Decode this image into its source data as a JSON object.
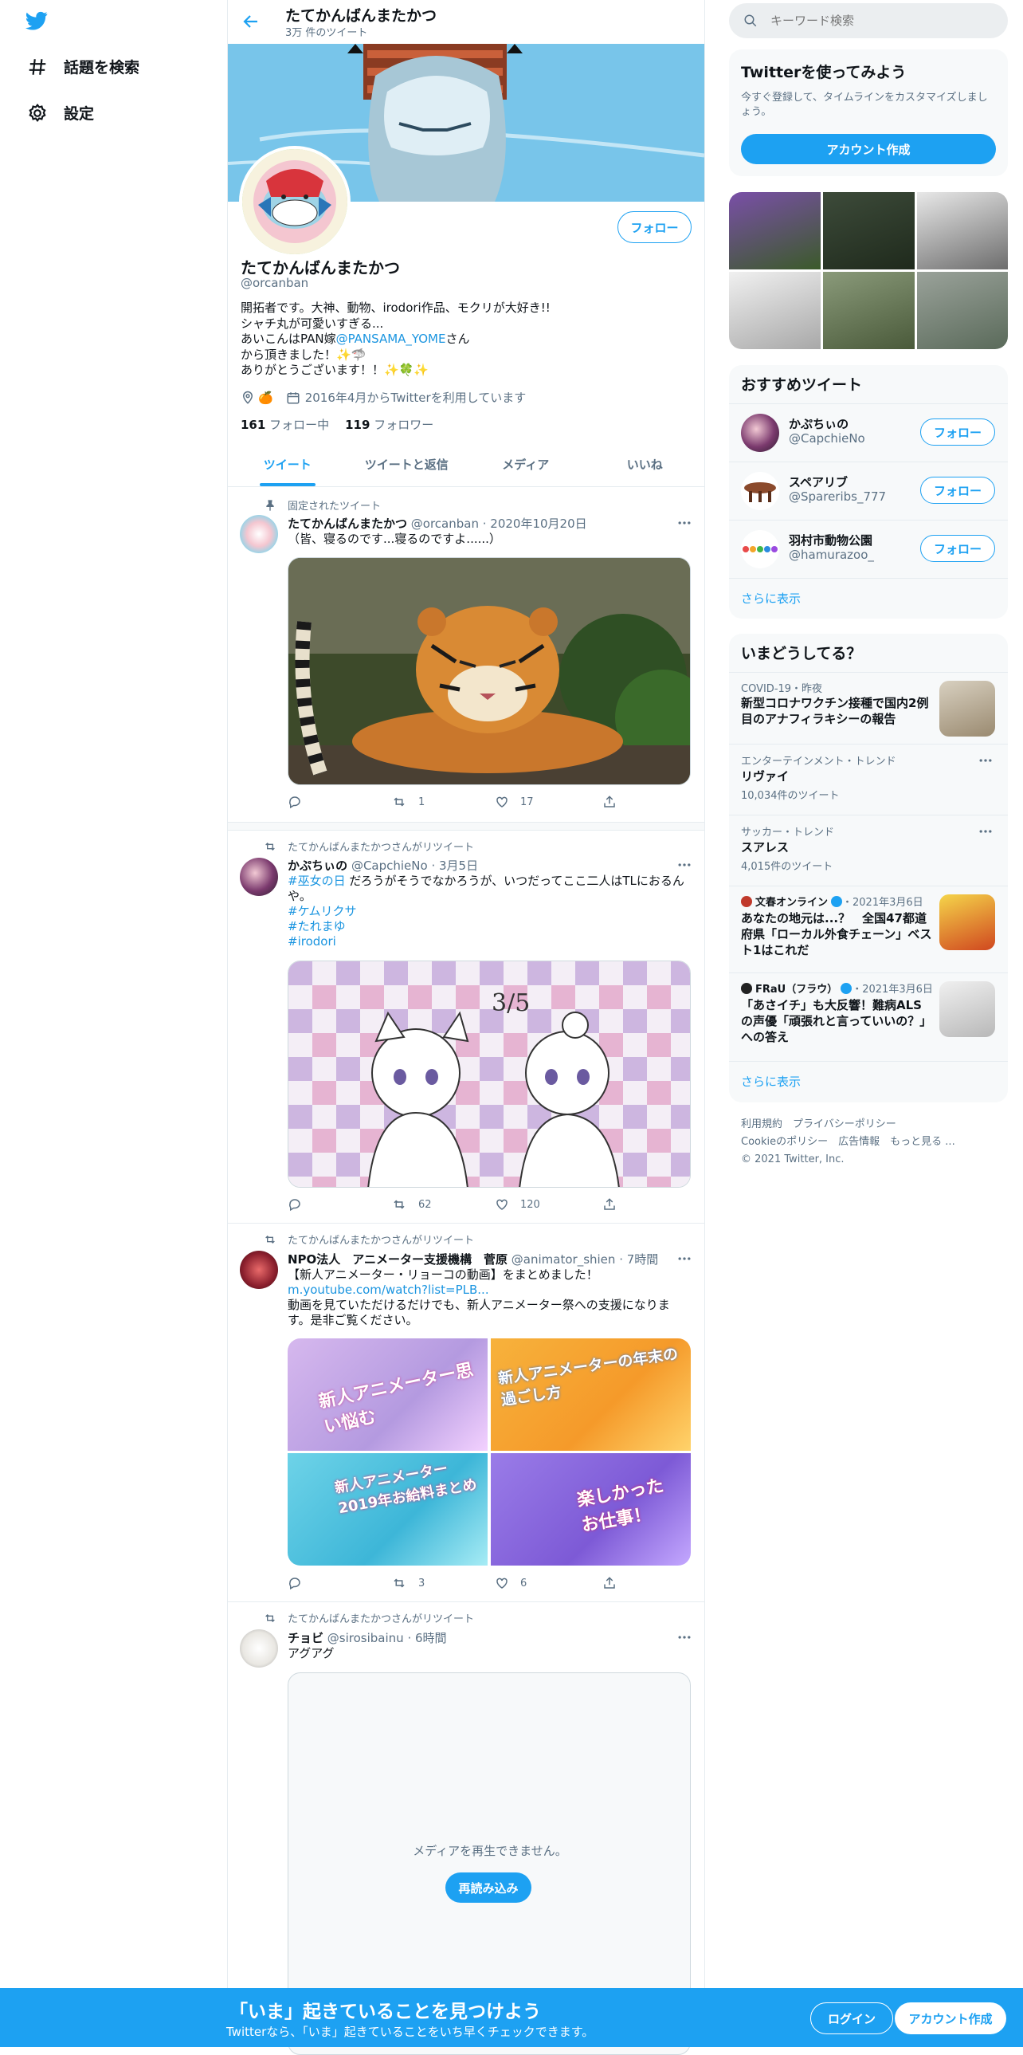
{
  "nav": {
    "explore_label": "話題を検索",
    "settings_label": "設定"
  },
  "profile": {
    "display_name": "たてかんばんまたかつ",
    "tweet_count": "3万 件のツイート",
    "handle": "@orcanban",
    "follow_button": "フォロー",
    "bio_lines": [
      "開拓者です。大神、動物、irodori作品、モクリが大好き!!",
      "シャチ丸が可愛いすぎる...",
      "あいこんはPAN嫁",
      "さん",
      "から頂きました！✨🦈",
      "ありがとうございます！！✨🍀✨"
    ],
    "bio_mention": "@PANSAMA_YOME",
    "location_emoji": "🍊",
    "joined": "2016年4月からTwitterを利用しています",
    "following_count": "161",
    "following_label": "フォロー中",
    "followers_count": "119",
    "followers_label": "フォロワー"
  },
  "tabs": [
    "ツイート",
    "ツイートと返信",
    "メディア",
    "いいね"
  ],
  "tweets": [
    {
      "context": "固定されたツイート",
      "name": "たてかんばんまたかつ",
      "handle": "@orcanban",
      "time": "2020年10月20日",
      "text": "（皆、寝るのです...寝るのですよ......）",
      "reply": "",
      "retweet": "1",
      "like": "17"
    },
    {
      "context": "たてかんばんまたかつさんがリツイート",
      "name": "かぷちぃの",
      "handle": "@CapchieNo",
      "time": "3月5日",
      "hashtag1": "#巫女の日",
      "text": " だろうがそうでなかろうが、いつだってここ二人はTLにおるんや。",
      "hashtag2": "#ケムリクサ",
      "hashtag3": "#たれまゆ",
      "hashtag4": "#irodori",
      "media_label": "3/5",
      "reply": "",
      "retweet": "62",
      "like": "120"
    },
    {
      "context": "たてかんばんまたかつさんがリツイート",
      "name": "NPO法人　アニメーター支援機構　菅原",
      "handle": "@animator_shien",
      "time": "7時間",
      "text1": "【新人アニメーター・リョーコの動画】をまとめました！",
      "link": "m.youtube.com/watch?list=PLB...",
      "text2": "動画を見ていただけるだけでも、新人アニメーター祭への支援になります。是非ご覧ください。",
      "media_titles": [
        "新人アニメーター思い悩む",
        "新人アニメーターの年末の過ごし方",
        "新人アニメーター2019年お給料まとめ",
        "楽しかったお仕事！"
      ],
      "reply": "",
      "retweet": "3",
      "like": "6"
    },
    {
      "context": "たてかんばんまたかつさんがリツイート",
      "name": "チョビ",
      "handle": "@sirosibainu",
      "time": "6時間",
      "text": "アグアグ",
      "media_error": "メディアを再生できません。",
      "reload": "再読み込み"
    }
  ],
  "right": {
    "search_placeholder": "キーワード検索",
    "signup_title": "Twitterを使ってみよう",
    "signup_desc": "今すぐ登録して、タイムラインをカスタマイズしましょう。",
    "signup_button": "アカウント作成",
    "suggest_title": "おすすめツイート",
    "suggest": [
      {
        "name": "かぷちぃの",
        "handle": "@CapchieNo",
        "button": "フォロー"
      },
      {
        "name": "スペアリブ",
        "handle": "@Spareribs_777",
        "button": "フォロー"
      },
      {
        "name": "羽村市動物公園",
        "handle": "@hamurazoo_",
        "button": "フォロー"
      }
    ],
    "show_more": "さらに表示",
    "trends_title": "いまどうしてる？",
    "trends": [
      {
        "meta": "COVID-19・昨夜",
        "title": "新型コロナワクチン接種で国内2例目のアナフィラキシーの報告"
      },
      {
        "meta": "エンターテインメント・トレンド",
        "title": "リヴァイ",
        "count": "10,034件のツイート"
      },
      {
        "meta": "サッカー・トレンド",
        "title": "スアレス",
        "count": "4,015件のツイート"
      },
      {
        "source": "文春オンライン",
        "date": "・2021年3月6日",
        "title": "あなたの地元は...？　全国47都道府県「ローカル外食チェーン」ベスト1はこれだ"
      },
      {
        "source": "FRaU（フラウ）",
        "date": "・2021年3月6日",
        "title": "「あさイチ」も大反響！難病ALSの声優「頑張れと言っていいの？」への答え"
      }
    ],
    "footer": [
      "利用規約",
      "プライバシーポリシー",
      "Cookieのポリシー",
      "広告情報",
      "もっと見る ...",
      "© 2021 Twitter, Inc."
    ]
  },
  "bottom_banner": {
    "title": "「いま」起きていることを見つけよう",
    "subtitle": "Twitterなら、「いま」起きていることをいち早くチェックできます。",
    "login": "ログイン",
    "signup": "アカウント作成"
  },
  "colors": {
    "accent": "#1da1f2",
    "like": "#e0245e",
    "retweet": "#17bf63",
    "text_secondary": "#5b7083"
  }
}
